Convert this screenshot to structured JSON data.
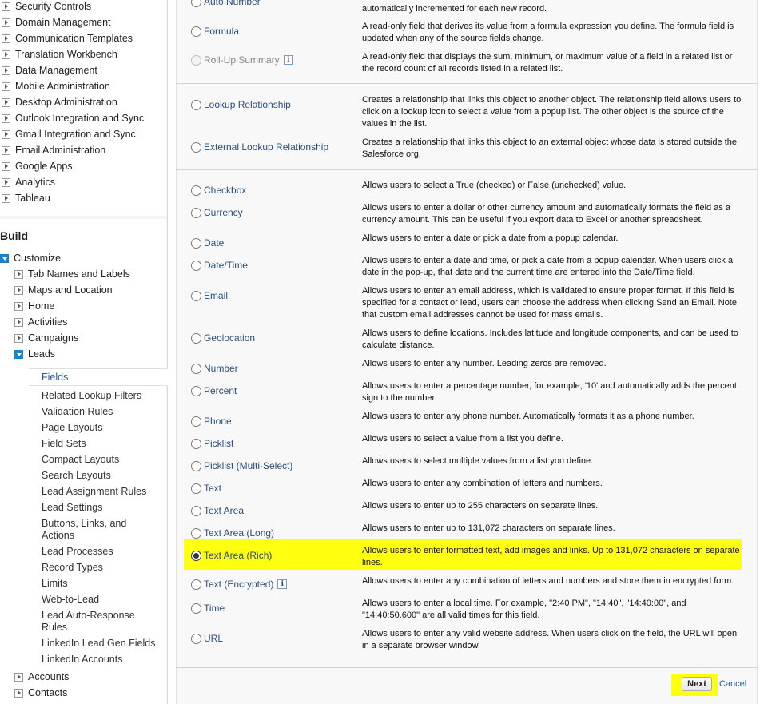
{
  "sidebar": {
    "top_items": [
      "Security Controls",
      "Domain Management",
      "Communication Templates",
      "Translation Workbench",
      "Data Management",
      "Mobile Administration",
      "Desktop Administration",
      "Outlook Integration and Sync",
      "Gmail Integration and Sync",
      "Email Administration",
      "Google Apps",
      "Analytics",
      "Tableau"
    ],
    "build_title": "Build",
    "customize": "Customize",
    "sub_items": [
      "Tab Names and Labels",
      "Maps and Location",
      "Home",
      "Activities",
      "Campaigns",
      "Leads"
    ],
    "leads_selected": "Fields",
    "leads_children": [
      "Related Lookup Filters",
      "Validation Rules",
      "Page Layouts",
      "Field Sets",
      "Compact Layouts",
      "Search Layouts",
      "Lead Assignment Rules",
      "Lead Settings",
      "Buttons, Links, and Actions",
      "Lead Processes",
      "Record Types",
      "Limits",
      "Web-to-Lead",
      "Lead Auto-Response Rules",
      "LinkedIn Lead Gen Fields",
      "LinkedIn Accounts"
    ],
    "bottom_items": [
      "Accounts",
      "Contacts"
    ]
  },
  "options": [
    {
      "label": "Auto Number",
      "desc": "automatically incremented for each new record."
    },
    {
      "label": "Formula",
      "desc": "A read-only field that derives its value from a formula expression you define. The formula field is updated when any of the source fields change."
    },
    {
      "label": "Roll-Up Summary",
      "desc": "A read-only field that displays the sum, minimum, or maximum value of a field in a related list or the record count of all records listed in a related list."
    },
    {
      "label": "Lookup Relationship",
      "desc": "Creates a relationship that links this object to another object. The relationship field allows users to click on a lookup icon to select a value from a popup list. The other object is the source of the values in the list."
    },
    {
      "label": "External Lookup Relationship",
      "desc": "Creates a relationship that links this object to an external object whose data is stored outside the Salesforce org."
    },
    {
      "label": "Checkbox",
      "desc": "Allows users to select a True (checked) or False (unchecked) value."
    },
    {
      "label": "Currency",
      "desc": "Allows users to enter a dollar or other currency amount and automatically formats the field as a currency amount. This can be useful if you export data to Excel or another spreadsheet."
    },
    {
      "label": "Date",
      "desc": "Allows users to enter a date or pick a date from a popup calendar."
    },
    {
      "label": "Date/Time",
      "desc": "Allows users to enter a date and time, or pick a date from a popup calendar. When users click a date in the pop-up, that date and the current time are entered into the Date/Time field."
    },
    {
      "label": "Email",
      "desc": "Allows users to enter an email address, which is validated to ensure proper format. If this field is specified for a contact or lead, users can choose the address when clicking Send an Email. Note that custom email addresses cannot be used for mass emails."
    },
    {
      "label": "Geolocation",
      "desc": "Allows users to define locations. Includes latitude and longitude components, and can be used to calculate distance."
    },
    {
      "label": "Number",
      "desc": "Allows users to enter any number. Leading zeros are removed."
    },
    {
      "label": "Percent",
      "desc": "Allows users to enter a percentage number, for example, '10' and automatically adds the percent sign to the number."
    },
    {
      "label": "Phone",
      "desc": "Allows users to enter any phone number. Automatically formats it as a phone number."
    },
    {
      "label": "Picklist",
      "desc": "Allows users to select a value from a list you define."
    },
    {
      "label": "Picklist (Multi-Select)",
      "desc": "Allows users to select multiple values from a list you define."
    },
    {
      "label": "Text",
      "desc": "Allows users to enter any combination of letters and numbers."
    },
    {
      "label": "Text Area",
      "desc": "Allows users to enter up to 255 characters on separate lines."
    },
    {
      "label": "Text Area (Long)",
      "desc": "Allows users to enter up to 131,072 characters on separate lines."
    },
    {
      "label": "Text Area (Rich)",
      "desc": "Allows users to enter formatted text, add images and links. Up to 131,072 characters on separate lines."
    },
    {
      "label": "Text (Encrypted)",
      "desc": "Allows users to enter any combination of letters and numbers and store them in encrypted form."
    },
    {
      "label": "Time",
      "desc": "Allows users to enter a local time. For example, \"2:40 PM\", \"14:40\", \"14:40:00\", and \"14:40:50.600\" are all valid times for this field."
    },
    {
      "label": "URL",
      "desc": "Allows users to enter any valid website address. When users click on the field, the URL will open in a separate browser window."
    }
  ],
  "selected_option": "Text Area (Rich)",
  "buttons": {
    "next": "Next",
    "cancel": "Cancel"
  },
  "colors": {
    "highlight": "#ffff10",
    "link": "#1b5fa8",
    "tree_accent": "#1b82c5"
  }
}
